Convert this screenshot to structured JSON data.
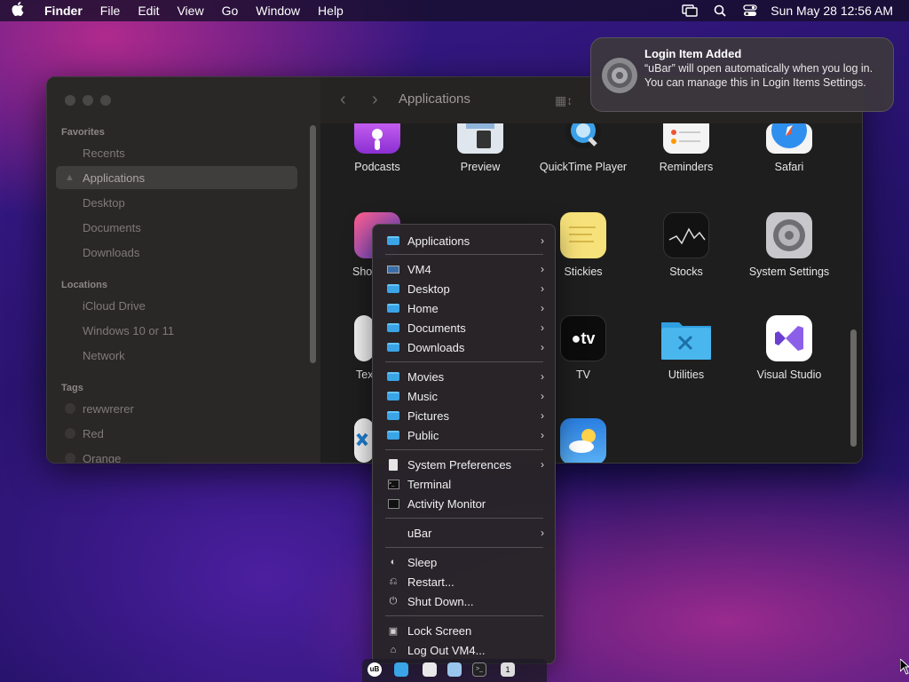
{
  "menubar": {
    "app_name": "Finder",
    "items": [
      "File",
      "Edit",
      "View",
      "Go",
      "Window",
      "Help"
    ],
    "clock": "Sun May 28  12:56 AM",
    "icons": [
      "apple-icon",
      "screen-mirror-icon",
      "spotlight-search-icon",
      "control-center-icon"
    ]
  },
  "finder": {
    "title": "Applications",
    "sidebar": {
      "favorites_header": "Favorites",
      "favorites": [
        "Recents",
        "Applications",
        "Desktop",
        "Documents",
        "Downloads"
      ],
      "locations_header": "Locations",
      "locations": [
        "iCloud Drive",
        "Windows 10 or 11",
        "Network"
      ],
      "tags_header": "Tags",
      "tags": [
        "rewwrerer",
        "Red",
        "Orange"
      ]
    },
    "apps": {
      "row1": [
        "Podcasts",
        "Preview",
        "QuickTime Player",
        "Reminders",
        "Safari"
      ],
      "row2_partial": "Sho",
      "row2": [
        "Stickies",
        "Stocks",
        "System Settings"
      ],
      "row3_partial": "Tex",
      "row3": [
        "TV",
        "Utilities",
        "Visual Studio"
      ]
    }
  },
  "notification": {
    "title": "Login Item Added",
    "body": "“uBar” will open automatically when you log in. You can manage this in Login Items Settings."
  },
  "context_menu": {
    "items": [
      {
        "label": "Applications",
        "submenu": true
      },
      {
        "label": "VM4",
        "submenu": true
      },
      {
        "label": "Desktop",
        "submenu": true
      },
      {
        "label": "Home",
        "submenu": true
      },
      {
        "label": "Documents",
        "submenu": true
      },
      {
        "label": "Downloads",
        "submenu": true
      },
      {
        "label": "Movies",
        "submenu": true
      },
      {
        "label": "Music",
        "submenu": true
      },
      {
        "label": "Pictures",
        "submenu": true
      },
      {
        "label": "Public",
        "submenu": true
      },
      {
        "label": "System Preferences",
        "submenu": true
      },
      {
        "label": "Terminal",
        "submenu": false
      },
      {
        "label": "Activity Monitor",
        "submenu": false
      },
      {
        "label": "uBar",
        "submenu": true
      },
      {
        "label": "Sleep",
        "submenu": false
      },
      {
        "label": "Restart...",
        "submenu": false
      },
      {
        "label": "Shut Down...",
        "submenu": false
      },
      {
        "label": "Lock Screen",
        "submenu": false
      },
      {
        "label": "Log Out VM4...",
        "submenu": false
      }
    ]
  },
  "dock": {
    "ubar_badge": "uB",
    "terminal_glyph": ">_",
    "activity_glyph": "1"
  },
  "colors": {
    "folder_blue": "#3aa4e6",
    "menu_bg": "#282428",
    "window_bg": "#1e1e1e"
  }
}
